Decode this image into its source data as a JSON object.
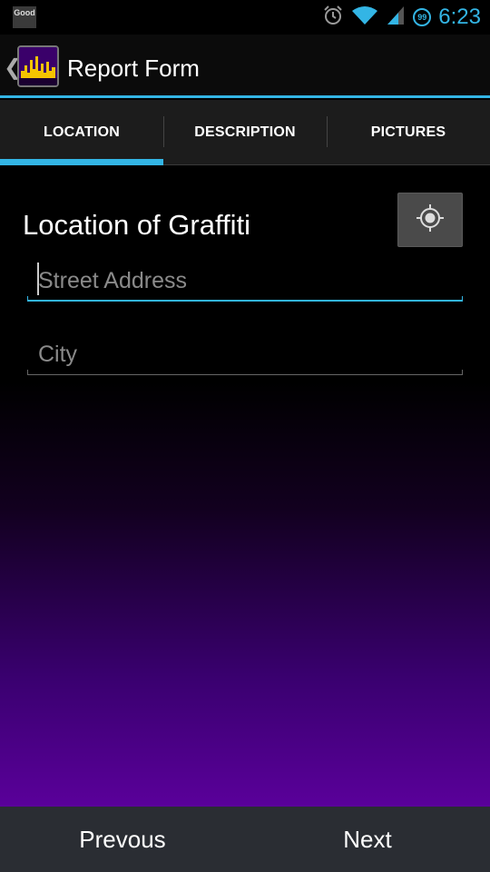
{
  "status_bar": {
    "notification_label": "Good",
    "battery_level": "99",
    "time": "6:23",
    "icons": [
      "alarm-icon",
      "wifi-icon",
      "signal-icon",
      "battery-icon"
    ]
  },
  "action_bar": {
    "title": "Report Form",
    "back_icon": "chevron-left-icon",
    "app_icon": "city-skyline-icon"
  },
  "tabs": [
    {
      "label": "LOCATION",
      "active": true
    },
    {
      "label": "DESCRIPTION",
      "active": false
    },
    {
      "label": "PICTURES",
      "active": false
    }
  ],
  "form": {
    "section_title": "Location of Graffiti",
    "locate_icon": "gps-locate-icon",
    "street": {
      "value": "",
      "placeholder": "Street Address"
    },
    "city": {
      "value": "",
      "placeholder": "City"
    }
  },
  "bottom_bar": {
    "previous_label": "Prevous",
    "next_label": "Next"
  },
  "colors": {
    "accent": "#33b5e5",
    "gradient_bottom": "#5a009a",
    "bottom_bar": "#2a2d33"
  }
}
